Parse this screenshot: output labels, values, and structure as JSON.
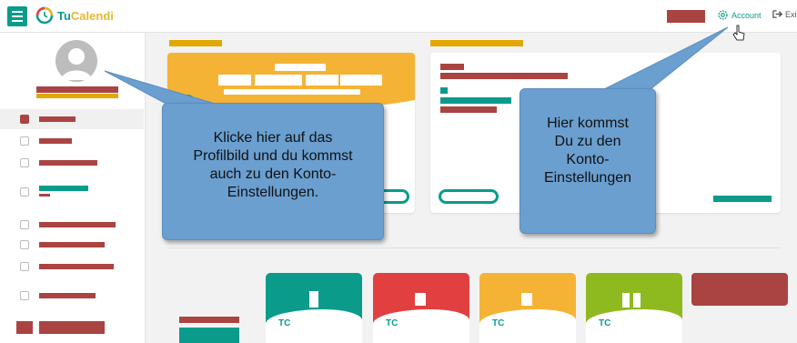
{
  "app": {
    "name_part1": "Tu",
    "name_part2": "Calendi"
  },
  "topbar": {
    "account_label": "Account",
    "exit_label": "Exit"
  },
  "callouts": {
    "profile": [
      "Klicke hier auf das",
      "Profilbild und du kommst",
      "auch zu den Konto-",
      "Einstellungen."
    ],
    "account": [
      "Hier kommst",
      "Du zu den",
      "Konto-",
      "Einstellungen"
    ]
  },
  "icons": [
    "menu-icon",
    "logo-icon",
    "gear-icon",
    "cursor-hand-icon",
    "exit-icon",
    "avatar-icon"
  ],
  "colors": {
    "teal": "#0a9b8b",
    "red": "#a94442",
    "orange": "#f5b335",
    "callout": "#6a9fd0",
    "lime": "#8fba1f",
    "tile_red": "#e24040"
  }
}
